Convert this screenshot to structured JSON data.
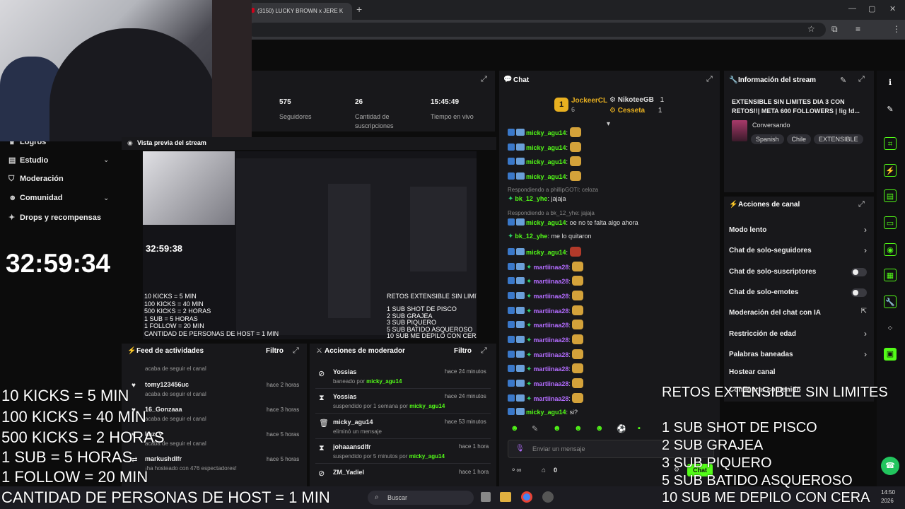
{
  "browser": {
    "tab_title": "(3150) LUCKY BROWN x JERE K",
    "new_tab": "+",
    "min": "—",
    "max": "▢",
    "close": "✕"
  },
  "nav": {
    "items": [
      {
        "label": "Logros",
        "icon": "trophy-icon"
      },
      {
        "label": "Estudio",
        "icon": "studio-icon"
      },
      {
        "label": "Moderación",
        "icon": "shield-icon"
      },
      {
        "label": "Comunidad",
        "icon": "community-icon"
      },
      {
        "label": "Drops y recompensas",
        "icon": "gift-icon"
      }
    ]
  },
  "stream_timer": "32:59:34",
  "stats": {
    "followers_value": "575",
    "followers_label": "Seguidores",
    "subs_value": "26",
    "subs_label": "Cantidad de suscripciones",
    "live_value": "15:45:49",
    "live_label": "Tiempo en vivo"
  },
  "preview": {
    "title": "Vista previa del stream",
    "timer": "32:59:38",
    "rules": [
      "10 KICKS = 5 MIN",
      "100 KICKS = 40 MIN",
      "500 KICKS = 2 HORAS",
      "1 SUB = 5 HORAS",
      " 1 FOLLOW = 20 MIN",
      "CANTIDAD DE PERSONAS DE HOST = 1 MIN"
    ],
    "retos_title": "RETOS EXTENSIBLE SIN LIMITES",
    "retos": [
      "1 SUB SHOT DE PISCO",
      "2 SUB  GRAJEA",
      "3 SUB PIQUERO",
      "5 SUB BATIDO ASQUEROSO",
      "10 SUB ME DEPILO CON CERA"
    ]
  },
  "chat": {
    "title": "Chat",
    "top_gifters": [
      {
        "rank": "1",
        "name": "JockeerCL",
        "count": "6"
      },
      {
        "name": "NikoteeGB",
        "count": "1"
      },
      {
        "name": "Cesseta",
        "count": "1"
      }
    ],
    "messages": [
      {
        "user": "micky_agu14",
        "color": "green",
        "text": "",
        "emote": true
      },
      {
        "user": "micky_agu14",
        "color": "green",
        "text": "",
        "emote": true
      },
      {
        "user": "micky_agu14",
        "color": "green",
        "text": "",
        "emote": true
      },
      {
        "user": "micky_agu14",
        "color": "green",
        "text": "",
        "emote": true
      },
      {
        "reply": "Respondiendo a phillipGOTI: celoza"
      },
      {
        "user": "bk_12_yhe",
        "color": "green",
        "text": "jajaja",
        "diamond": true
      },
      {
        "reply": "Respondiendo a bk_12_yhe: jajaja"
      },
      {
        "user": "micky_agu14",
        "color": "green",
        "text": "oe no te falta algo ahora"
      },
      {
        "user": "bk_12_yhe",
        "color": "green",
        "text": "me lo quitaron",
        "diamond": true
      },
      {
        "user": "micky_agu14",
        "color": "green",
        "text": "",
        "emote": "red"
      },
      {
        "user": "martiinaa28",
        "color": "purple",
        "text": "",
        "emote": true
      },
      {
        "user": "martiinaa28",
        "color": "purple",
        "text": "",
        "emote": true
      },
      {
        "user": "martiinaa28",
        "color": "purple",
        "text": "",
        "emote": true
      },
      {
        "user": "martiinaa28",
        "color": "purple",
        "text": "",
        "emote": true
      },
      {
        "user": "martiinaa28",
        "color": "purple",
        "text": "",
        "emote": true
      },
      {
        "user": "martiinaa28",
        "color": "purple",
        "text": "",
        "emote": true
      },
      {
        "user": "martiinaa28",
        "color": "purple",
        "text": "",
        "emote": true
      },
      {
        "user": "martiinaa28",
        "color": "purple",
        "text": "",
        "emote": true
      },
      {
        "user": "martiinaa28",
        "color": "purple",
        "text": "",
        "emote": true
      },
      {
        "user": "martiinaa28",
        "color": "purple",
        "text": "",
        "emote": true
      },
      {
        "user": "micky_agu14",
        "color": "green",
        "text": "si?"
      }
    ],
    "input_placeholder": "Enviar un mensaje",
    "send_label": "Chat",
    "points": "0"
  },
  "info": {
    "title": "Información del stream",
    "stream_title": "EXTENSIBLE SIN LIMITES DIA 3 CON RETOS!!| META 600 FOLLOWERS | !ig !d...",
    "category": "Conversando",
    "tags": [
      "Spanish",
      "Chile",
      "EXTENSIBLE"
    ]
  },
  "actions": {
    "title": "Acciones de canal",
    "items": [
      {
        "label": "Modo lento",
        "control": "chevron"
      },
      {
        "label": "Chat de solo-seguidores",
        "control": "chevron"
      },
      {
        "label": "Chat de solo-suscriptores",
        "control": "toggle"
      },
      {
        "label": "Chat de solo-emotes",
        "control": "toggle"
      },
      {
        "label": "Moderación del chat con IA",
        "control": "link"
      },
      {
        "label": "Restricción de edad",
        "control": "chevron"
      },
      {
        "label": "Palabras baneadas",
        "control": "chevron"
      },
      {
        "label": "Hostear canal",
        "control": "none"
      },
      {
        "label": "Configurar contenido",
        "control": "none"
      }
    ]
  },
  "feed": {
    "title": "Feed de actividades",
    "filter": "Filtro",
    "items": [
      {
        "name": "",
        "sub": "acaba de seguir el canal",
        "time": ""
      },
      {
        "name": "tomy123456uc",
        "sub": "acaba de seguir el canal",
        "time": "hace 2 horas"
      },
      {
        "name": "16_Gonzaaa",
        "sub": "acaba de seguir el canal",
        "time": "hace 3 horas"
      },
      {
        "name": "kaz_y",
        "sub": "acaba de seguir el canal",
        "time": "hace 5 horas"
      },
      {
        "name": "markushdlfr",
        "sub": "¡ha hosteado con 476 espectadores!",
        "time": "hace 5 horas"
      }
    ]
  },
  "mod": {
    "title": "Acciones de moderador",
    "filter": "Filtro",
    "items": [
      {
        "name": "Yossias",
        "sub": "baneado por",
        "by": "micky_agu14",
        "time": "hace 24 minutos",
        "icon": "ban-icon"
      },
      {
        "name": "Yossias",
        "sub": "suspendido por 1 semana por",
        "by": "micky_agu14",
        "time": "hace 24 minutos",
        "icon": "hourglass-icon"
      },
      {
        "name": "micky_agu14",
        "sub": "eliminó un mensaje",
        "by": "",
        "time": "hace 53 minutos",
        "icon": "trash-icon"
      },
      {
        "name": "johaaansdlfr",
        "sub": "suspendido por 5 minutos por",
        "by": "micky_agu14",
        "time": "hace 1 hora",
        "icon": "hourglass-icon"
      },
      {
        "name": "ZM_Yadiel",
        "sub": "",
        "by": "",
        "time": "hace 1 hora",
        "icon": "ban-icon"
      }
    ]
  },
  "overlay": {
    "rules": [
      "10 KICKS = 5 MIN",
      "100 KICKS = 40 MIN",
      "500 KICKS = 2 HORAS",
      "1 SUB = 5 HORAS",
      " 1 FOLLOW = 20 MIN",
      "CANTIDAD DE PERSONAS DE HOST = 1 MIN"
    ],
    "retos_title": "RETOS EXTENSIBLE SIN LIMITES",
    "retos": [
      "1 SUB SHOT DE PISCO",
      "2 SUB  GRAJEA",
      "3 SUB PIQUERO",
      "5 SUB BATIDO ASQUEROSO",
      "10 SUB ME DEPILO CON CERA"
    ]
  },
  "taskbar": {
    "search": "Buscar",
    "time": "14:50",
    "date": "2026"
  },
  "colors": {
    "accent": "#53fc18",
    "purple_user": "#b36cff"
  }
}
